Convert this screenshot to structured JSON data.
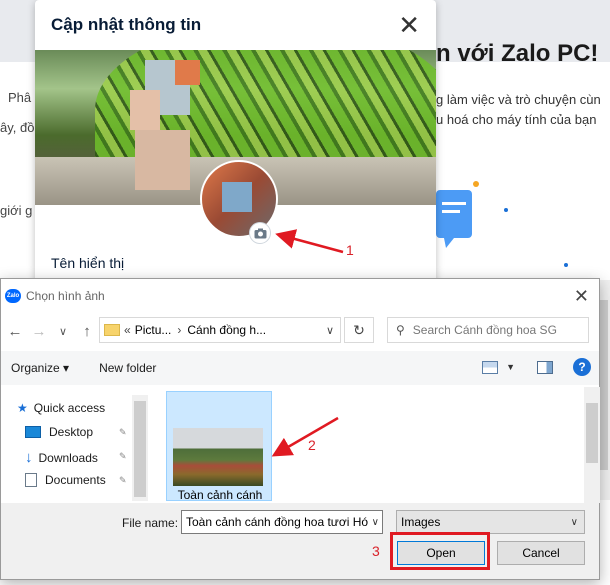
{
  "background": {
    "headline": "n với Zalo PC!",
    "line1": "g làm việc và trò chuyện cùn",
    "line2": "u hoá cho máy tính của bạn",
    "left_frag1": "Phâ",
    "left_frag2": "ây, đồ",
    "left_frag3": "giới g"
  },
  "modal": {
    "title": "Cập nhật thông tin",
    "close_icon": "close-icon",
    "display_name_label": "Tên hiển thị",
    "camera_icon": "camera-icon"
  },
  "dialog": {
    "title": "Chọn hình ảnh",
    "logo_text": "Zalo",
    "close_label": "✕",
    "address": {
      "prefix": "«",
      "segment1": "Pictu...",
      "separator": "›",
      "segment2": "Cánh đồng h..."
    },
    "search_placeholder": "Search Cánh đồng hoa SG",
    "toolbar": {
      "organize_label": "Organize ▾",
      "new_folder_label": "New folder",
      "help_label": "?"
    },
    "nav_items": [
      {
        "label": "Quick access",
        "icon": "star-icon"
      },
      {
        "label": "Desktop",
        "icon": "desktop-icon"
      },
      {
        "label": "Downloads",
        "icon": "download-icon"
      },
      {
        "label": "Documents",
        "icon": "documents-icon"
      }
    ],
    "file": {
      "name": "Toàn cảnh cánh"
    },
    "file_name_label": "File name:",
    "file_name_value": "Toàn cảnh cánh đồng hoa tươi Hó",
    "file_type_value": "Images",
    "open_label": "Open",
    "cancel_label": "Cancel"
  },
  "annotations": {
    "step1": "1",
    "step2": "2",
    "step3": "3",
    "color": "#e01a22"
  }
}
